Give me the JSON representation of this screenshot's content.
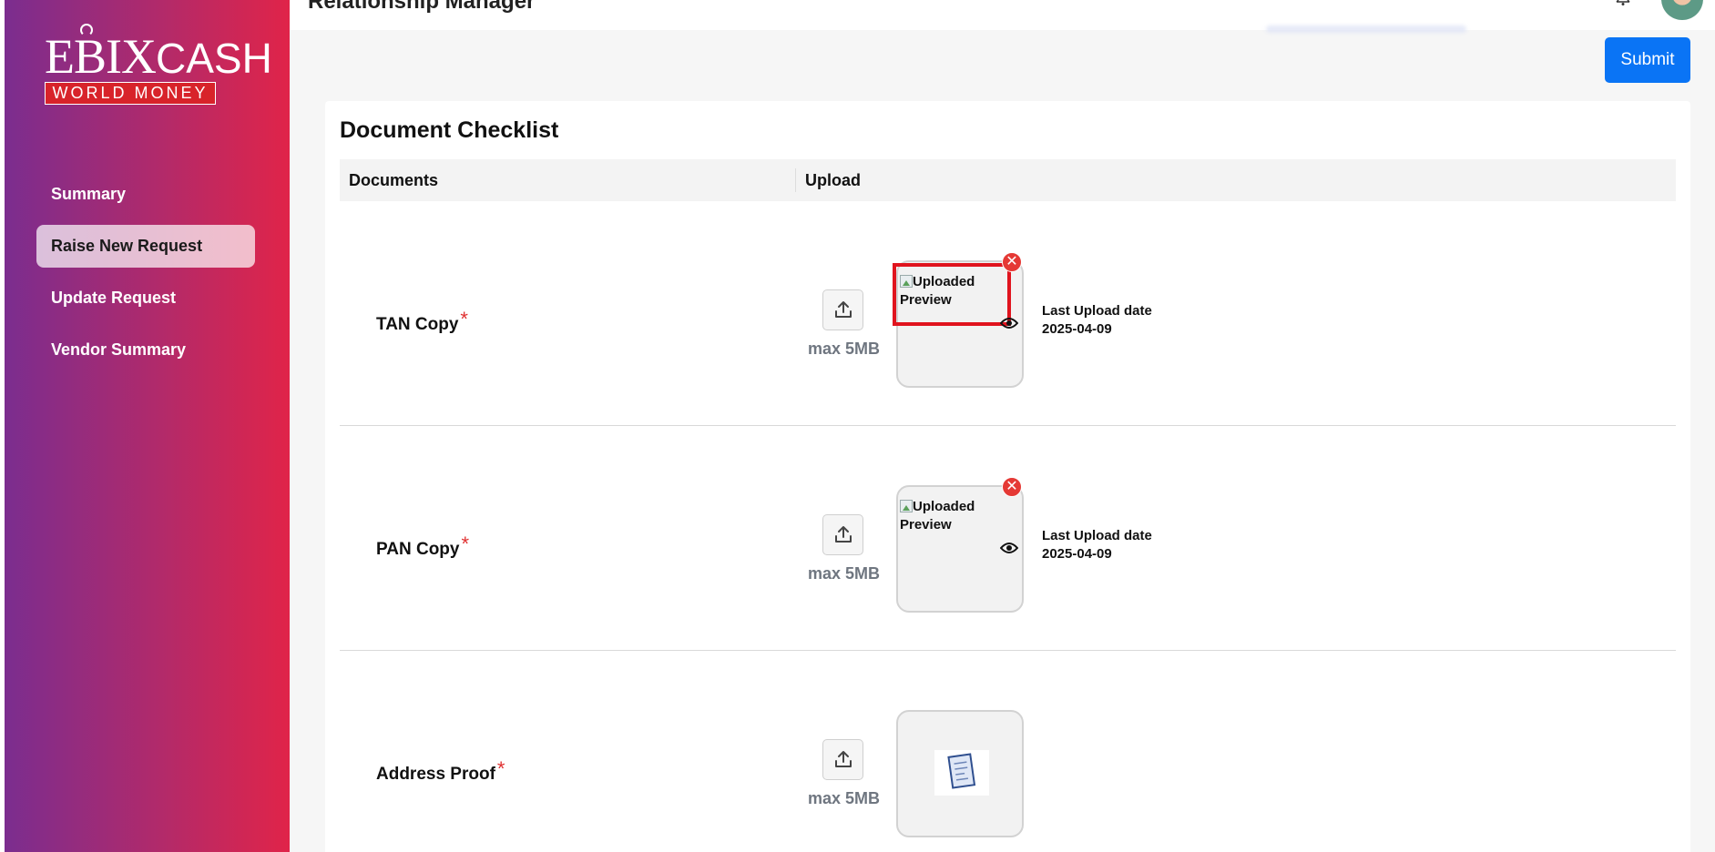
{
  "header": {
    "title": "Relationship Manager"
  },
  "logo": {
    "brand": "EBIX",
    "brand2": "CASH",
    "tagline": "WORLD MONEY"
  },
  "sidebar": {
    "items": [
      {
        "label": "Summary",
        "active": false
      },
      {
        "label": "Raise New Request",
        "active": true
      },
      {
        "label": "Update Request",
        "active": false
      },
      {
        "label": "Vendor Summary",
        "active": false
      }
    ]
  },
  "actions": {
    "submit_label": "Submit"
  },
  "checklist": {
    "title": "Document Checklist",
    "columns": [
      "Documents",
      "Upload"
    ],
    "rows": [
      {
        "name": "TAN Copy",
        "required_mark": "*",
        "max_size": "max 5MB",
        "preview_alt": "Uploaded Preview",
        "last_upload_label": "Last Upload date",
        "last_upload_date": "2025-04-09"
      },
      {
        "name": "PAN Copy",
        "required_mark": "*",
        "max_size": "max 5MB",
        "preview_alt": "Uploaded Preview",
        "last_upload_label": "Last Upload date",
        "last_upload_date": "2025-04-09"
      },
      {
        "name": "Address Proof",
        "required_mark": "*",
        "max_size": "max 5MB"
      }
    ]
  },
  "colors": {
    "accent": "#0a74f5",
    "required": "#e03131",
    "remove": "#e53935",
    "sidebar_start": "#7b2d8f",
    "sidebar_end": "#e02449"
  }
}
